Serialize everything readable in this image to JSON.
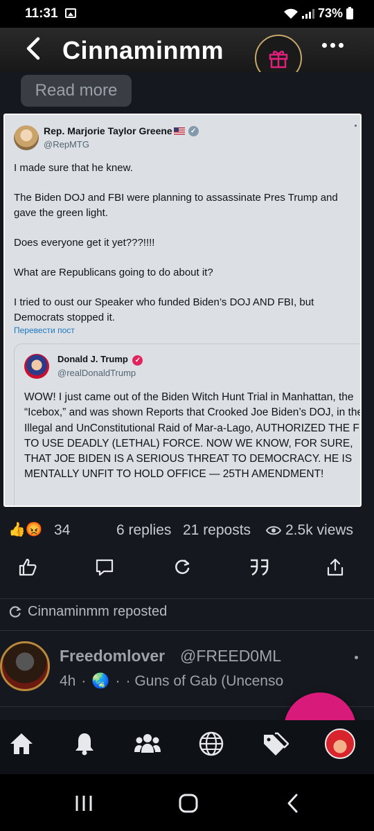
{
  "status_bar": {
    "time": "11:31",
    "battery": "73%"
  },
  "header": {
    "title": "Cinnaminmm"
  },
  "post": {
    "read_more": "Read more",
    "screenshot": {
      "author_name": "Rep. Marjorie Taylor Greene",
      "author_handle": "@RepMTG",
      "paragraphs": [
        "I made sure that he knew.",
        "The Biden DOJ and FBI were planning to assassinate Pres Trump and gave the green light.",
        "Does everyone get it yet???!!!!",
        "What are Republicans going to do about it?",
        "I tried to oust our Speaker who funded Biden’s DOJ AND FBI, but Democrats stopped it."
      ],
      "translate_link": "Перевести пост",
      "quote": {
        "author_name": "Donald J. Trump",
        "author_handle": "@realDonaldTrump",
        "text": "WOW! I just came out of the Biden Witch Hunt Trial in Manhattan, the “Icebox,” and was shown Reports that Crooked Joe Biden’s DOJ, in their Illegal and UnConstitutional Raid of Mar-a-Lago, AUTHORIZED THE FBI TO USE DEADLY (LETHAL) FORCE. NOW WE KNOW, FOR SURE, THAT JOE BIDEN IS A SERIOUS THREAT TO DEMOCRACY. HE IS MENTALLY UNFIT TO HOLD OFFICE — 25TH AMENDMENT!"
      }
    },
    "stats": {
      "reaction_emojis": "👍😡",
      "reaction_count": "34",
      "replies": "6 replies",
      "reposts": "21 reposts",
      "views": "2.5k views"
    }
  },
  "repost_notice": "Cinnaminmm reposted",
  "next_post": {
    "author_name": "Freedomlover",
    "author_handle": "@FREED0ML",
    "time": "4h",
    "separator": "·",
    "group": "· Guns of Gab (Uncenso"
  },
  "colors": {
    "accent": "#d81b7a",
    "background": "#15181e",
    "verified_mtg": "#829aab",
    "verified_trump": "#e0245e"
  }
}
